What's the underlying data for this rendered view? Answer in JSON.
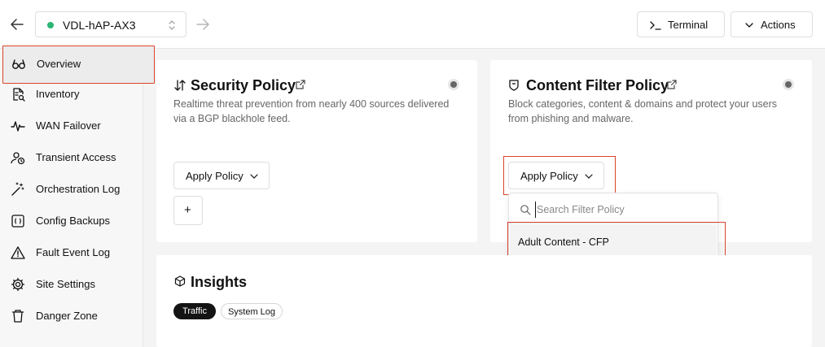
{
  "header": {
    "device_name": "VDL-hAP-AX3",
    "device_status_color": "#2bb673",
    "terminal_label": "Terminal",
    "actions_label": "Actions"
  },
  "sidebar": {
    "items": [
      {
        "label": "Overview",
        "icon": "glasses-icon"
      },
      {
        "label": "Inventory",
        "icon": "document-search-icon"
      },
      {
        "label": "WAN Failover",
        "icon": "pulse-icon"
      },
      {
        "label": "Transient Access",
        "icon": "user-clock-icon"
      },
      {
        "label": "Orchestration Log",
        "icon": "magic-wand-icon"
      },
      {
        "label": "Config Backups",
        "icon": "file-braces-icon"
      },
      {
        "label": "Fault Event Log",
        "icon": "warning-icon"
      },
      {
        "label": "Site Settings",
        "icon": "gear-icon"
      },
      {
        "label": "Danger Zone",
        "icon": "trash-icon"
      }
    ]
  },
  "security_policy": {
    "title": "Security Policy",
    "description_line1": "Realtime threat prevention from nearly 400 sources delivered",
    "description_line2": "via a BGP blackhole feed.",
    "apply_label": "Apply Policy",
    "add_label": "+"
  },
  "content_filter_policy": {
    "title": "Content Filter Policy",
    "description_line1": "Block categories, content & domains and protect your users",
    "description_line2": "from phishing and malware.",
    "apply_label": "Apply Policy",
    "dropdown": {
      "search_placeholder": "Search Filter Policy",
      "search_value": "",
      "options": [
        "Adult Content - CFP"
      ]
    }
  },
  "insights": {
    "title": "Insights",
    "tabs": [
      "Traffic",
      "System Log"
    ],
    "active_tab": "Traffic"
  },
  "colors": {
    "highlight": "#d9442b",
    "active_pill": "#141414"
  }
}
